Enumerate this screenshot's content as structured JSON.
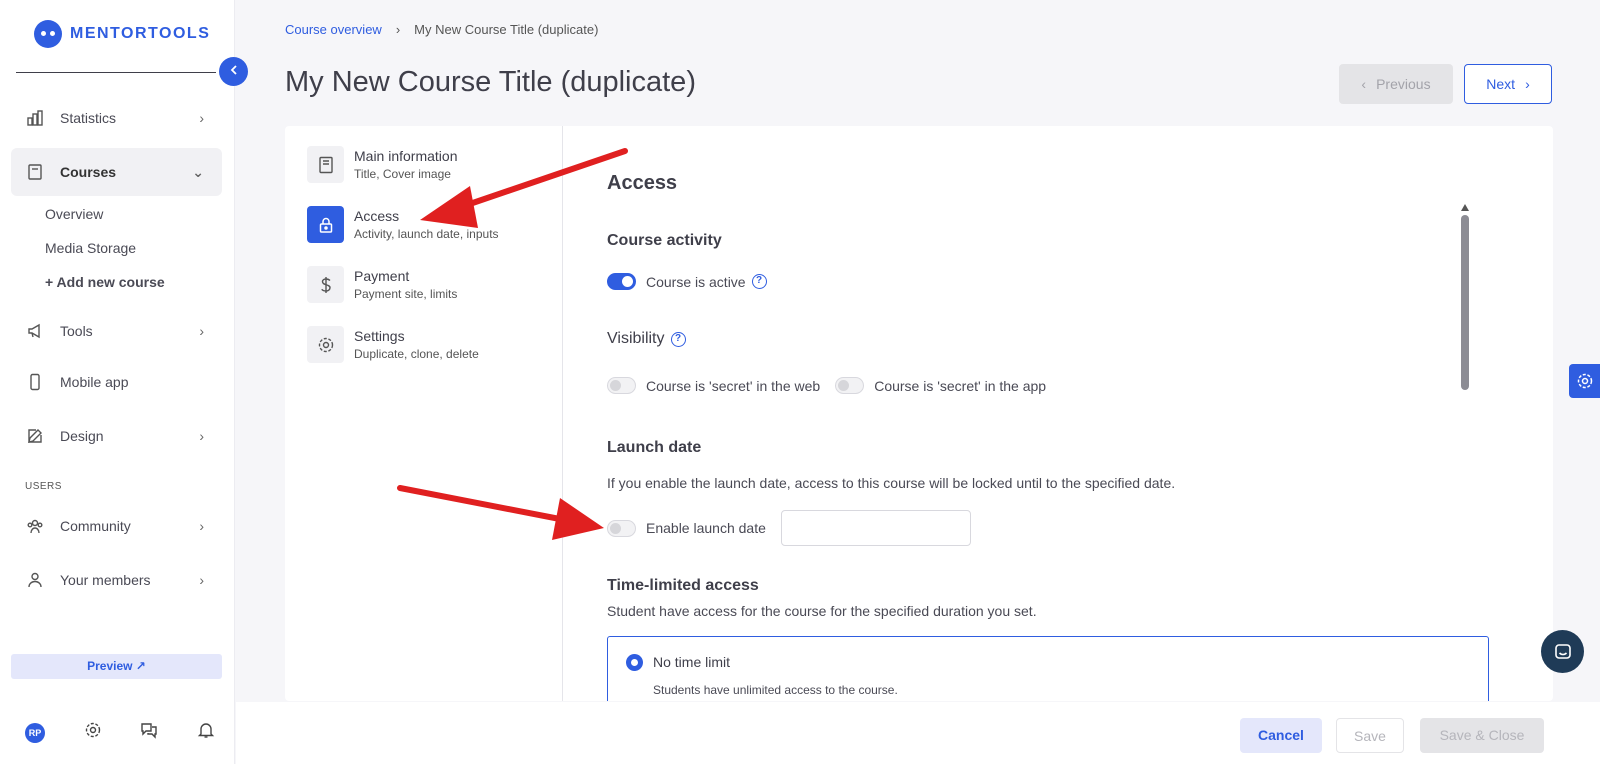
{
  "app": {
    "logo_text": "MENTORTOOLS"
  },
  "sidebar": {
    "items": [
      {
        "label": "Statistics",
        "icon": "bar-chart-icon",
        "chevron": "›"
      },
      {
        "label": "Courses",
        "icon": "book-icon",
        "chevron": "⌄"
      },
      {
        "label": "Tools",
        "icon": "megaphone-icon",
        "chevron": "›"
      },
      {
        "label": "Mobile app",
        "icon": "phone-icon"
      },
      {
        "label": "Design",
        "icon": "pencil-icon",
        "chevron": "›"
      },
      {
        "label": "Community",
        "icon": "people-icon",
        "chevron": "›"
      },
      {
        "label": "Your members",
        "icon": "person-icon",
        "chevron": "›"
      }
    ],
    "course_subitems": [
      "Overview",
      "Media Storage",
      "+ Add new course"
    ],
    "section_users": "USERS",
    "preview": "Preview ↗",
    "avatar_initials": "RP"
  },
  "breadcrumb": {
    "link": "Course overview",
    "separator": "›",
    "current": "My New Course Title (duplicate)"
  },
  "page": {
    "title": "My New Course Title (duplicate)"
  },
  "nav_buttons": {
    "previous": "Previous",
    "next": "Next",
    "prev_chevron": "‹",
    "next_chevron": "›"
  },
  "steps": [
    {
      "title": "Main information",
      "subtitle": "Title, Cover image",
      "icon": "book-icon"
    },
    {
      "title": "Access",
      "subtitle": "Activity, launch date, inputs",
      "icon": "lock-icon"
    },
    {
      "title": "Payment",
      "subtitle": "Payment site, limits",
      "icon": "dollar-icon"
    },
    {
      "title": "Settings",
      "subtitle": "Duplicate, clone, delete",
      "icon": "gear-icon"
    }
  ],
  "access": {
    "heading": "Access",
    "course_activity": {
      "heading": "Course activity",
      "toggle_label": "Course is active",
      "toggle_on": true
    },
    "visibility": {
      "heading": "Visibility",
      "web_label": "Course is 'secret' in the web",
      "app_label": "Course is 'secret' in the app"
    },
    "launch_date": {
      "heading": "Launch date",
      "description": "If you enable the launch date, access to this course will be locked until to the specified date.",
      "toggle_label": "Enable launch date",
      "date_value": ""
    },
    "time_limited": {
      "heading": "Time-limited access",
      "description": "Student have access for the course for the specified duration you set.",
      "option_title": "No time limit",
      "option_subtitle": "Students have unlimited access to the course."
    },
    "help_glyph": "?"
  },
  "footer": {
    "cancel": "Cancel",
    "save": "Save",
    "save_close": "Save & Close"
  },
  "colors": {
    "accent": "#2f5de0",
    "annotation_arrow": "#e02020"
  }
}
